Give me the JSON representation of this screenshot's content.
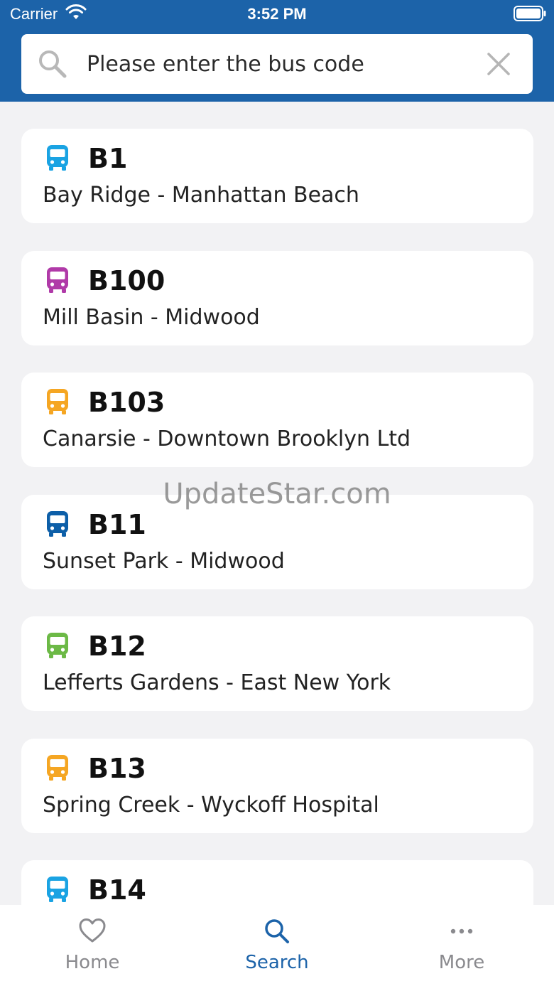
{
  "status_bar": {
    "carrier": "Carrier",
    "time": "3:52 PM"
  },
  "search": {
    "placeholder": "Please enter the bus code",
    "value": ""
  },
  "routes": [
    {
      "code": "B1",
      "name": "Bay Ridge - Manhattan Beach",
      "color": "#1aa3e3"
    },
    {
      "code": "B100",
      "name": "Mill Basin - Midwood",
      "color": "#b03aa8"
    },
    {
      "code": "B103",
      "name": "Canarsie - Downtown Brooklyn Ltd",
      "color": "#f5a623"
    },
    {
      "code": "B11",
      "name": "Sunset Park - Midwood",
      "color": "#0d5fa8"
    },
    {
      "code": "B12",
      "name": "Lefferts Gardens - East New York",
      "color": "#6cb946"
    },
    {
      "code": "B13",
      "name": "Spring Creek - Wyckoff Hospital",
      "color": "#f5a623"
    },
    {
      "code": "B14",
      "name": "",
      "color": "#1aa3e3"
    }
  ],
  "watermark": "UpdateStar.com",
  "tabs": [
    {
      "label": "Home",
      "icon": "heart-icon",
      "active": false
    },
    {
      "label": "Search",
      "icon": "search-icon",
      "active": true
    },
    {
      "label": "More",
      "icon": "more-icon",
      "active": false
    }
  ],
  "colors": {
    "header": "#1c63a9",
    "accent": "#1c63a9",
    "inactive": "#8a8a8e",
    "background": "#f2f2f4"
  }
}
